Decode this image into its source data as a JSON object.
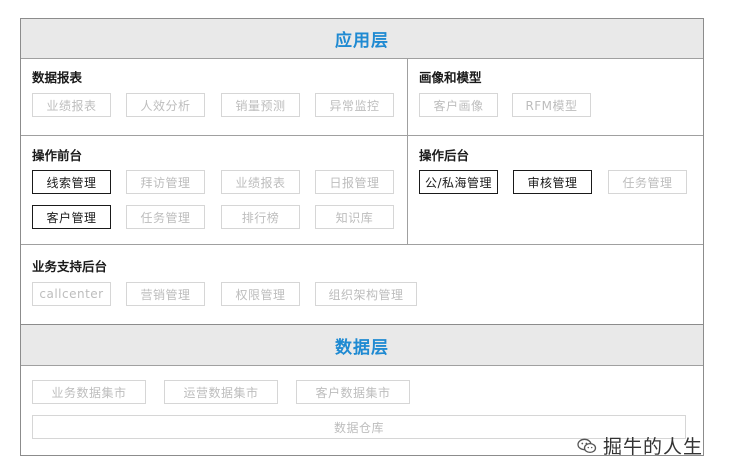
{
  "application_layer": {
    "title": "应用层",
    "data_reports": {
      "title": "数据报表",
      "items": [
        "业绩报表",
        "人效分析",
        "销量预测",
        "异常监控"
      ]
    },
    "portrait_model": {
      "title": "画像和模型",
      "items": [
        "客户画像",
        "RFM模型"
      ]
    },
    "ops_front": {
      "title": "操作前台",
      "row1": [
        "线索管理",
        "拜访管理",
        "业绩报表",
        "日报管理"
      ],
      "row2": [
        "客户管理",
        "任务管理",
        "排行榜",
        "知识库"
      ]
    },
    "ops_back": {
      "title": "操作后台",
      "items": [
        "公/私海管理",
        "审核管理",
        "任务管理"
      ]
    },
    "biz_support": {
      "title": "业务支持后台",
      "items": [
        "callcenter",
        "营销管理",
        "权限管理",
        "组织架构管理"
      ]
    }
  },
  "data_layer": {
    "title": "数据层",
    "marts": [
      "业务数据集市",
      "运营数据集市",
      "客户数据集市"
    ],
    "warehouse": "数据仓库"
  },
  "watermark": {
    "text": "掘牛的人生",
    "icon": "wechat-icon"
  },
  "colors": {
    "header_text": "#1f8ad2",
    "header_bg": "#e9e9e9",
    "active_border": "#1a1a1a",
    "inactive_text": "#bdbdbd"
  }
}
